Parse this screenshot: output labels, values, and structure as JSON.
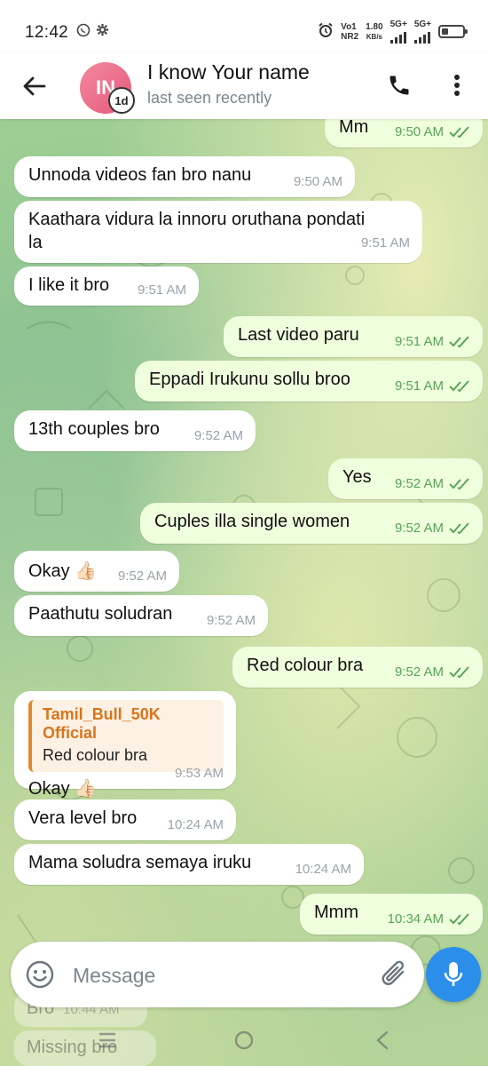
{
  "status_bar": {
    "time": "12:42",
    "net_top": "Vo1",
    "net_bottom": "NR2",
    "speed_top": "1.80",
    "speed_bottom": "KB/s",
    "sim1": "5G+",
    "sim2": "5G+"
  },
  "header": {
    "avatar_initials": "IN",
    "avatar_badge": "1d",
    "title": "I know Your name",
    "subtitle": "last seen recently"
  },
  "messages": [
    {
      "dir": "out",
      "text": "Mm",
      "time": "9:50 AM"
    },
    {
      "dir": "in",
      "text": "Unnoda videos fan bro nanu",
      "time": "9:50 AM"
    },
    {
      "dir": "in",
      "text": "Kaathara vidura la innoru oruthana pondati\nla",
      "time": "9:51 AM"
    },
    {
      "dir": "in",
      "text": "I like it bro",
      "time": "9:51 AM"
    },
    {
      "dir": "out",
      "text": "Last video paru",
      "time": "9:51 AM"
    },
    {
      "dir": "out",
      "text": "Eppadi Irukunu sollu broo",
      "time": "9:51 AM"
    },
    {
      "dir": "in",
      "text": "13th couples bro",
      "time": "9:52 AM"
    },
    {
      "dir": "out",
      "text": "Yes",
      "time": "9:52 AM"
    },
    {
      "dir": "out",
      "text": "Cuples illa single women",
      "time": "9:52 AM"
    },
    {
      "dir": "in",
      "text": "Okay 👍🏻",
      "time": "9:52 AM"
    },
    {
      "dir": "in",
      "text": "Paathutu soludran",
      "time": "9:52 AM"
    },
    {
      "dir": "out",
      "text": "Red colour bra",
      "time": "9:52 AM"
    },
    {
      "dir": "in",
      "reply_name": "Tamil_Bull_50K Official",
      "reply_text": "Red colour bra",
      "text": "Okay 👍🏻",
      "time": "9:53 AM"
    },
    {
      "dir": "in",
      "text": "Vera level bro",
      "time": "10:24 AM"
    },
    {
      "dir": "in",
      "text": "Mama soludra semaya iruku",
      "time": "10:24 AM"
    },
    {
      "dir": "out",
      "text": "Mmm",
      "time": "10:34 AM"
    },
    {
      "dir": "in",
      "text": "Bro",
      "time": "10:44 AM"
    },
    {
      "dir": "in",
      "text": "Missing bro",
      "time": ""
    }
  ],
  "composer": {
    "placeholder": "Message"
  },
  "colors": {
    "incoming_bubble": "#ffffff",
    "outgoing_bubble": "#efffde",
    "outgoing_time": "#5aa356",
    "accent_blue": "#2b8ee8",
    "reply_accent": "#e08a2b"
  }
}
